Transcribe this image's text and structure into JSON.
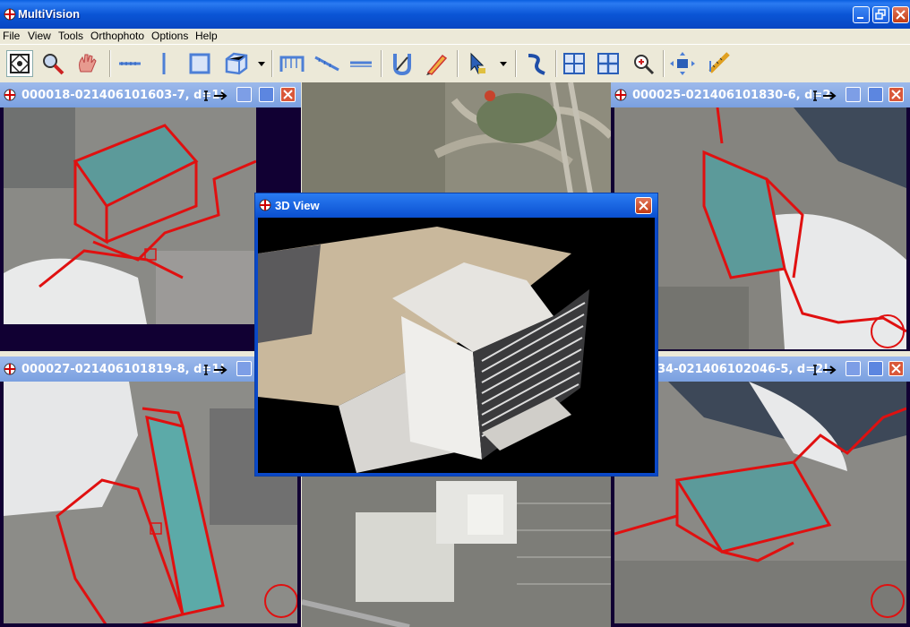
{
  "window": {
    "title": "MultiVision"
  },
  "menu": {
    "items": [
      "File",
      "View",
      "Tools",
      "Orthophoto",
      "Options",
      "Help"
    ]
  },
  "toolbar": {
    "icons": [
      "grid-select-icon",
      "magnifier-icon",
      "hand-pan-icon",
      "horizontal-line-icon",
      "vertical-line-icon",
      "rectangle-icon",
      "box-3d-icon",
      "bridge-icon",
      "slope-icon",
      "ruler-icon",
      "magnet-icon",
      "pen-icon",
      "pointer-icon",
      "curve-icon",
      "tile-4-icon",
      "tile-grid-icon",
      "zoom-icon",
      "camera-move-icon",
      "measure-icon"
    ]
  },
  "image_windows": [
    {
      "id": "tl",
      "title": "000018-021406101603-7, d=1!"
    },
    {
      "id": "tr",
      "title": "000025-021406101830-6, d=2"
    },
    {
      "id": "bl",
      "title": "000027-021406101819-8, d=1!"
    },
    {
      "id": "br",
      "title": "34-021406102046-5, d=2!"
    }
  ],
  "dialog": {
    "title": "3D View"
  }
}
